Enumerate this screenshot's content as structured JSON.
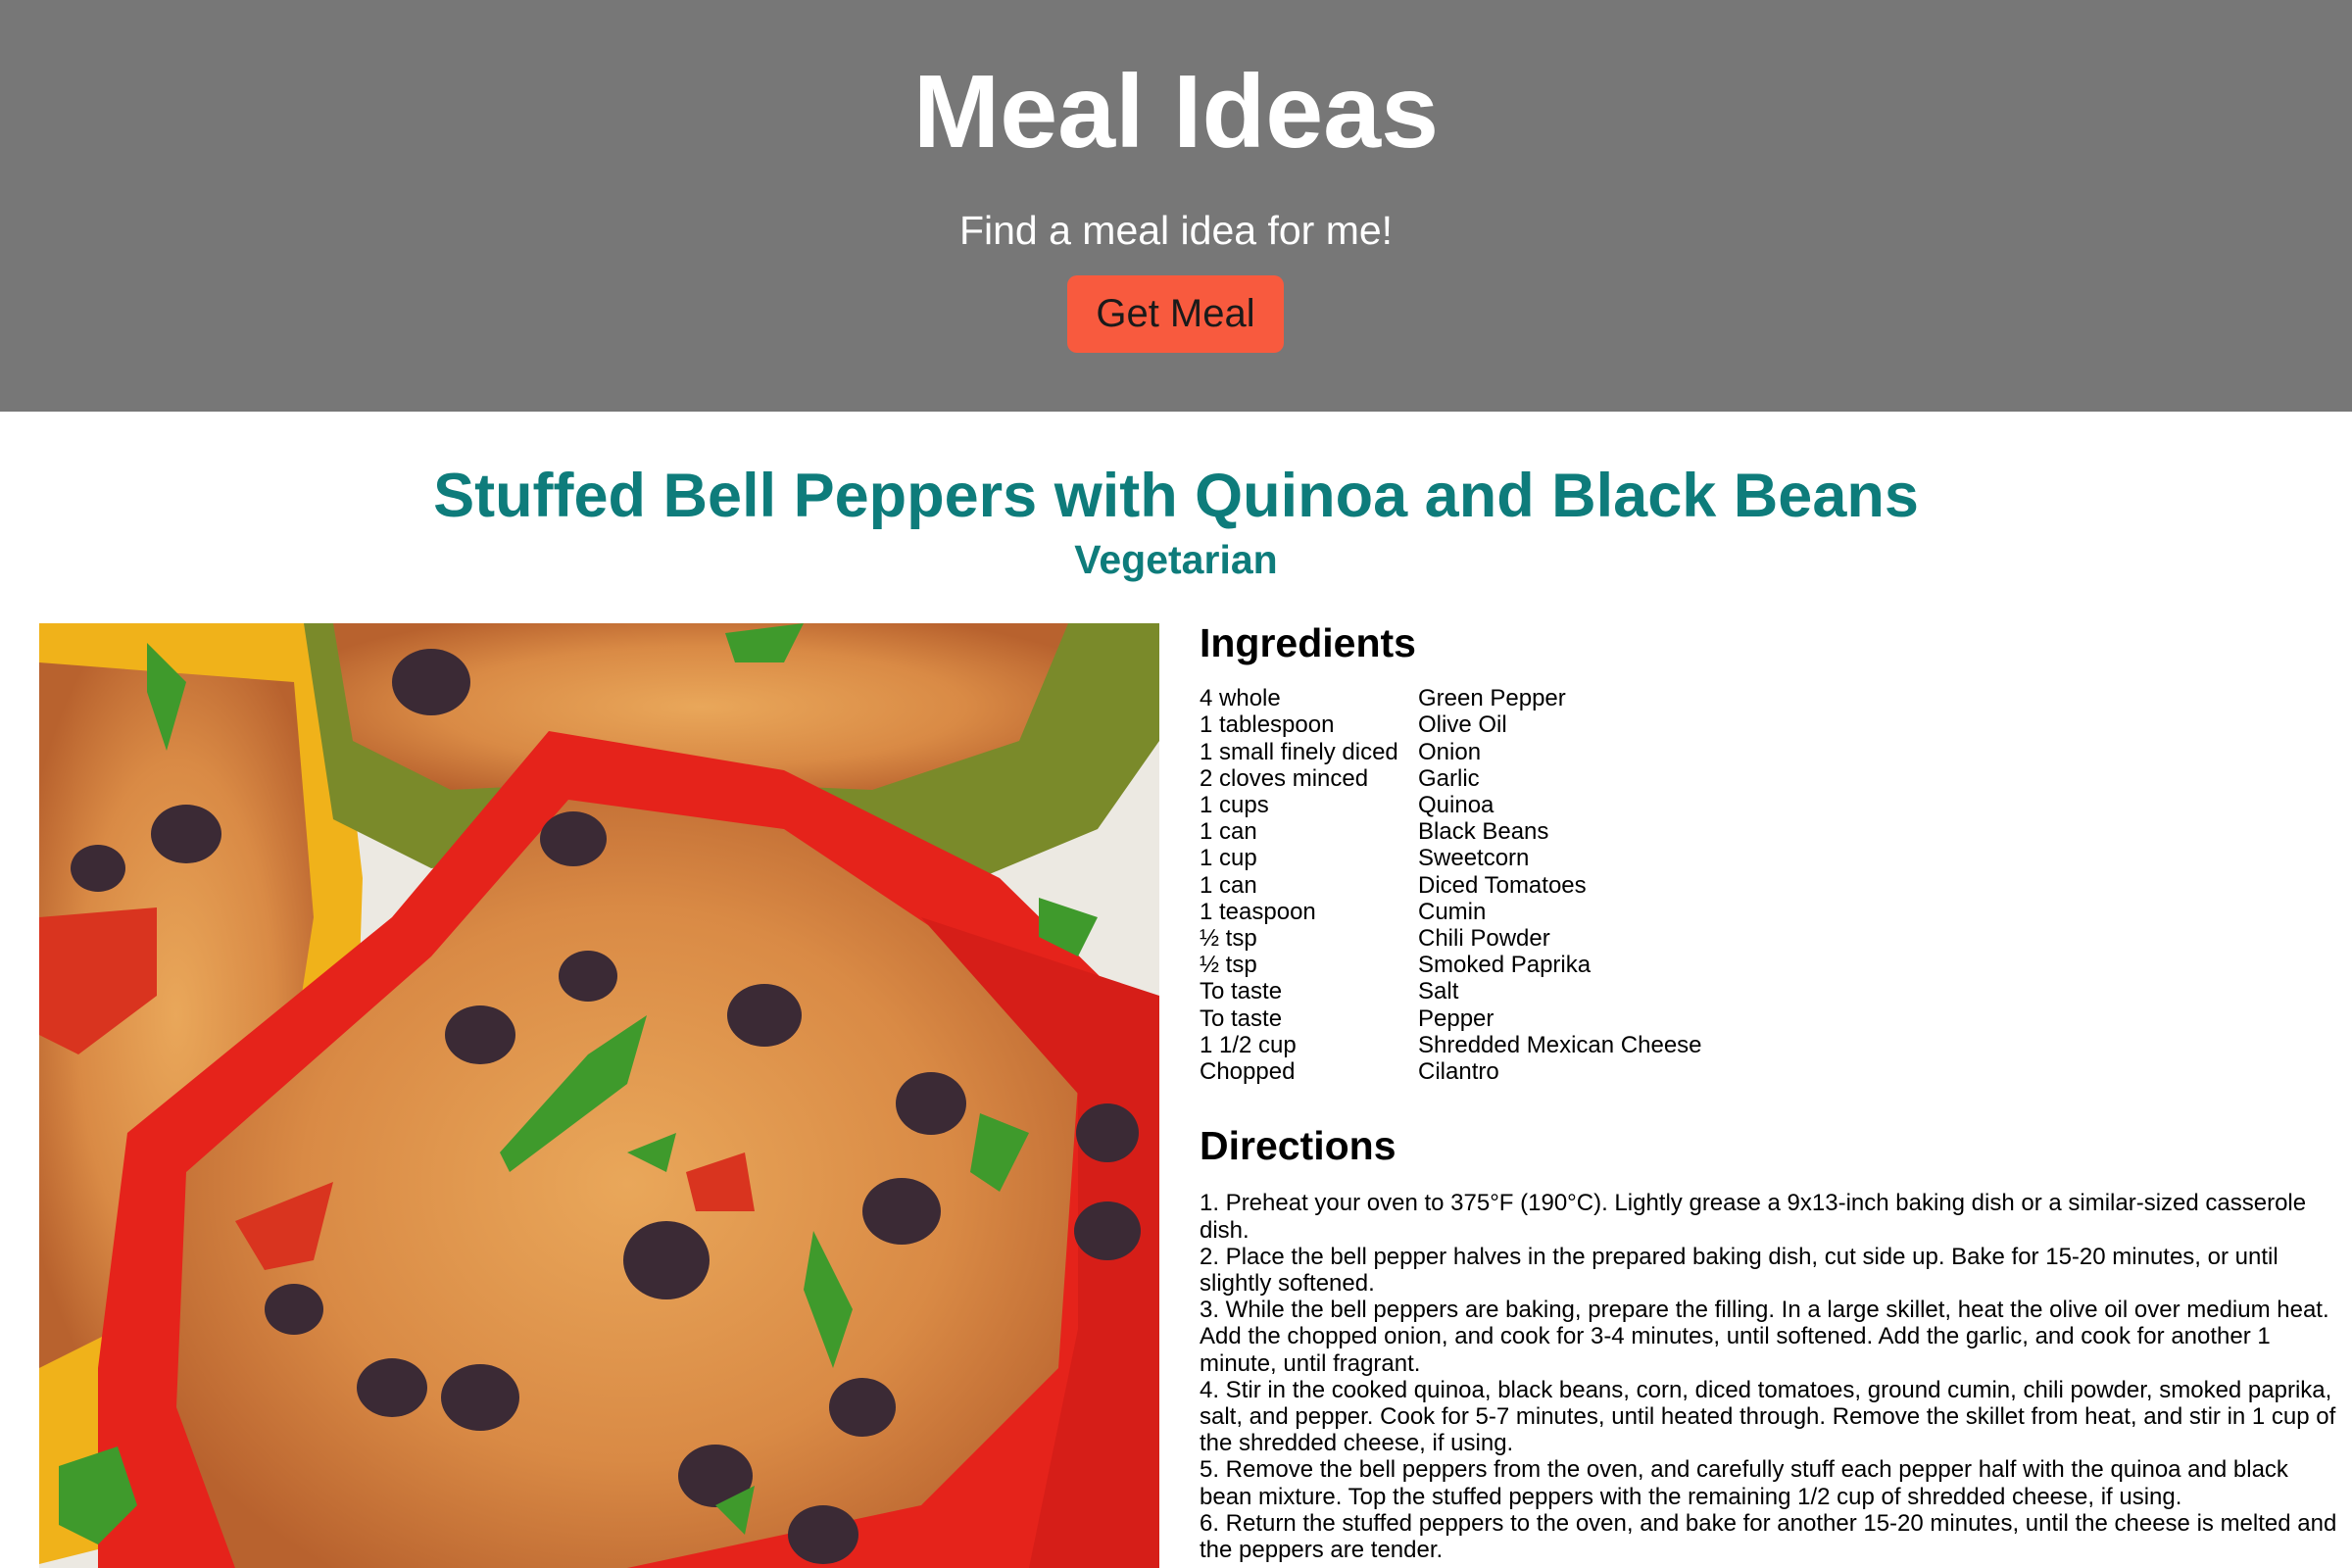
{
  "header": {
    "title": "Meal Ideas",
    "tagline": "Find a meal idea for me!",
    "button_label": "Get Meal"
  },
  "meal": {
    "name": "Stuffed Bell Peppers with Quinoa and Black Beans",
    "category": "Vegetarian",
    "image_alt": "stuffed-bell-peppers-photo"
  },
  "ingredients_heading": "Ingredients",
  "ingredients": [
    {
      "measure": "4 whole",
      "item": "Green Pepper"
    },
    {
      "measure": "1 tablespoon",
      "item": "Olive Oil"
    },
    {
      "measure": "1 small finely diced",
      "item": "Onion"
    },
    {
      "measure": "2 cloves minced",
      "item": "Garlic"
    },
    {
      "measure": "1 cups",
      "item": "Quinoa"
    },
    {
      "measure": "1 can",
      "item": "Black Beans"
    },
    {
      "measure": "1 cup",
      "item": "Sweetcorn"
    },
    {
      "measure": "1 can",
      "item": "Diced Tomatoes"
    },
    {
      "measure": "1 teaspoon",
      "item": "Cumin"
    },
    {
      "measure": "½ tsp",
      "item": "Chili Powder"
    },
    {
      "measure": "½ tsp",
      "item": "Smoked Paprika"
    },
    {
      "measure": "To taste",
      "item": "Salt"
    },
    {
      "measure": "To taste",
      "item": "Pepper"
    },
    {
      "measure": "1 1/2 cup",
      "item": "Shredded Mexican Cheese"
    },
    {
      "measure": "Chopped",
      "item": "Cilantro"
    }
  ],
  "directions_heading": "Directions",
  "directions": [
    "1. Preheat your oven to 375°F (190°C). Lightly grease a 9x13-inch baking dish or a similar-sized casserole dish.",
    "2. Place the bell pepper halves in the prepared baking dish, cut side up. Bake for 15-20 minutes, or until slightly softened.",
    "3. While the bell peppers are baking, prepare the filling. In a large skillet, heat the olive oil over medium heat. Add the chopped onion, and cook for 3-4 minutes, until softened. Add the garlic, and cook for another 1 minute, until fragrant.",
    "4. Stir in the cooked quinoa, black beans, corn, diced tomatoes, ground cumin, chili powder, smoked paprika, salt, and pepper. Cook for 5-7 minutes, until heated through. Remove the skillet from heat, and stir in 1 cup of the shredded cheese, if using.",
    "5. Remove the bell peppers from the oven, and carefully stuff each pepper half with the quinoa and black bean mixture. Top the stuffed peppers with the remaining 1/2 cup of shredded cheese, if using.",
    "6. Return the stuffed peppers to the oven, and bake for another 15-20 minutes, until the cheese is melted and the peppers are tender."
  ],
  "colors": {
    "header_bg": "#777777",
    "button_bg": "#f85a3e",
    "accent": "#0e7c7b"
  }
}
